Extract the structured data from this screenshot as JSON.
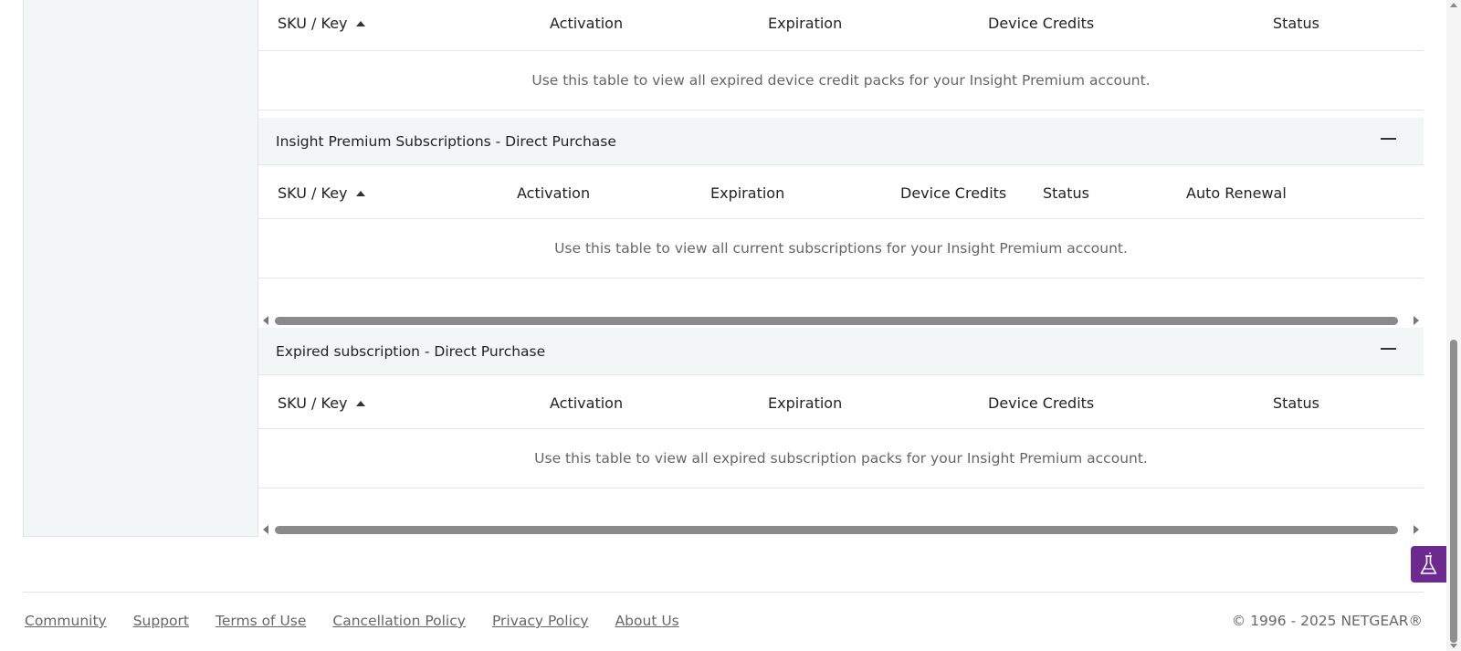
{
  "sections": [
    {
      "id": "expired-device-credits",
      "title": "",
      "columns": [
        "SKU / Key",
        "Activation",
        "Expiration",
        "Device Credits",
        "Status"
      ],
      "empty_message": "Use this table to view all expired device credit packs for your Insight Premium account."
    },
    {
      "id": "premium-subscriptions",
      "title": "Insight Premium Subscriptions - Direct Purchase",
      "columns": [
        "SKU / Key",
        "Activation",
        "Expiration",
        "Device Credits",
        "Status",
        "Auto Renewal"
      ],
      "empty_message": "Use this table to view all current subscriptions for your Insight Premium account."
    },
    {
      "id": "expired-subscriptions",
      "title": "Expired subscription - Direct Purchase",
      "columns": [
        "SKU / Key",
        "Activation",
        "Expiration",
        "Device Credits",
        "Status"
      ],
      "empty_message": "Use this table to view all expired subscription packs for your Insight Premium account."
    }
  ],
  "icons": {
    "sort": "sort-ascending-icon",
    "collapse": "minus-icon",
    "lab": "flask-icon"
  },
  "footer": {
    "links": [
      "Community",
      "Support",
      "Terms of Use",
      "Cancellation Policy",
      "Privacy Policy",
      "About Us"
    ],
    "copyright": "© 1996 - 2025 NETGEAR®"
  },
  "colors": {
    "lab_button": "#6c2a8f",
    "section_header_bg": "#f3f6f7",
    "left_pane_bg": "#f2f6f7"
  }
}
